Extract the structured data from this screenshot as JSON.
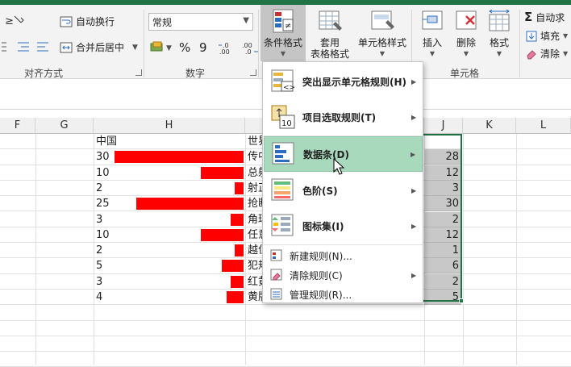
{
  "ribbon": {
    "alignment": {
      "wrap_label": "自动换行",
      "merge_label": "合并后居中",
      "group_label": "对齐方式"
    },
    "number": {
      "format_value": "常规",
      "percent_label": "%",
      "comma_label": "9",
      "dec_inc_label": "←.0 .00",
      "dec_dec_label": ".00 →.0",
      "group_label": "数字"
    },
    "styles": {
      "cond_format_label": "条件格式",
      "table_format_label_1": "套用",
      "table_format_label_2": "表格格式",
      "cell_style_label": "单元格样式"
    },
    "cells": {
      "insert_label": "插入",
      "delete_label": "删除",
      "format_label": "格式",
      "group_label": "单元格"
    },
    "editing": {
      "autosum_label": "自动求",
      "fill_label": "填充",
      "clear_label": "清除"
    }
  },
  "columns": [
    "F",
    "G",
    "H",
    "I",
    "J",
    "K",
    "L"
  ],
  "rows": [
    {
      "g": "",
      "h_text": "中国",
      "i_text": "世界",
      "j": ""
    },
    {
      "h": "30",
      "h_frac": 1.0,
      "i_text": "传中",
      "j": "28"
    },
    {
      "h": "10",
      "h_frac": 0.333,
      "i_text": "总射",
      "j": "12"
    },
    {
      "h": "2",
      "h_frac": 0.067,
      "i_text": "射正",
      "j": "3"
    },
    {
      "h": "25",
      "h_frac": 0.833,
      "i_text": "抢断",
      "j": "30"
    },
    {
      "h": "3",
      "h_frac": 0.1,
      "i_text": "角球",
      "j": "2"
    },
    {
      "h": "10",
      "h_frac": 0.333,
      "i_text": "任意",
      "j": "12"
    },
    {
      "h": "2",
      "h_frac": 0.067,
      "i_text": "越位",
      "j": "1"
    },
    {
      "h": "5",
      "h_frac": 0.167,
      "i_text": "犯规",
      "j": "6"
    },
    {
      "h": "3",
      "h_frac": 0.1,
      "i_text": "红黄",
      "j": "2"
    },
    {
      "h": "4",
      "h_frac": 0.133,
      "i_text": "黄牌",
      "j": "5"
    }
  ],
  "menu": {
    "items": [
      {
        "label": "突出显示单元格规则(H)",
        "icon": "highlight-rules-icon",
        "has_sub": true
      },
      {
        "label": "项目选取规则(T)",
        "icon": "top-bottom-rules-icon",
        "has_sub": true
      },
      {
        "label": "数据条(D)",
        "icon": "data-bars-icon",
        "has_sub": true
      },
      {
        "label": "色阶(S)",
        "icon": "color-scales-icon",
        "has_sub": true
      },
      {
        "label": "图标集(I)",
        "icon": "icon-sets-icon",
        "has_sub": true
      }
    ],
    "small_items": [
      {
        "label": "新建规则(N)...",
        "icon": "new-rule-icon",
        "has_sub": false
      },
      {
        "label": "清除规则(C)",
        "icon": "clear-rules-icon",
        "has_sub": true
      },
      {
        "label": "管理规则(R)...",
        "icon": "manage-rules-icon",
        "has_sub": false
      }
    ]
  },
  "colors": {
    "accent": "#217346",
    "bar": "#ff0000",
    "highlight": "#a9d9bd"
  }
}
